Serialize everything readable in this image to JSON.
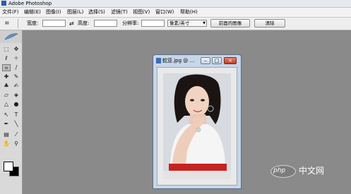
{
  "titlebar": {
    "title": "Adobe Photoshop"
  },
  "menubar": {
    "items": [
      {
        "label": "文件(F)"
      },
      {
        "label": "编辑(E)"
      },
      {
        "label": "图像(I)"
      },
      {
        "label": "图层(L)"
      },
      {
        "label": "选择(S)"
      },
      {
        "label": "滤镜(T)"
      },
      {
        "label": "视图(V)"
      },
      {
        "label": "窗口(W)"
      },
      {
        "label": "帮助(H)"
      }
    ]
  },
  "options": {
    "width_label": "宽度:",
    "height_label": "高度:",
    "swap_icon": "swap-arrows-icon",
    "resolution_label": "分辨率:",
    "unit_value": "像素/英寸",
    "front_image_button": "前面的图像",
    "clear_button": "清除",
    "width_value": "",
    "height_value": "",
    "resolution_value": ""
  },
  "document": {
    "title": "蛇亚.jpg @ ...",
    "minimize": "–",
    "maximize": "□",
    "close": "×"
  },
  "watermark": {
    "logo": "php",
    "text": "中文网"
  },
  "colors": {
    "workspace": "#8a8a8a",
    "foreground": "#ffffff",
    "background": "#000000"
  }
}
